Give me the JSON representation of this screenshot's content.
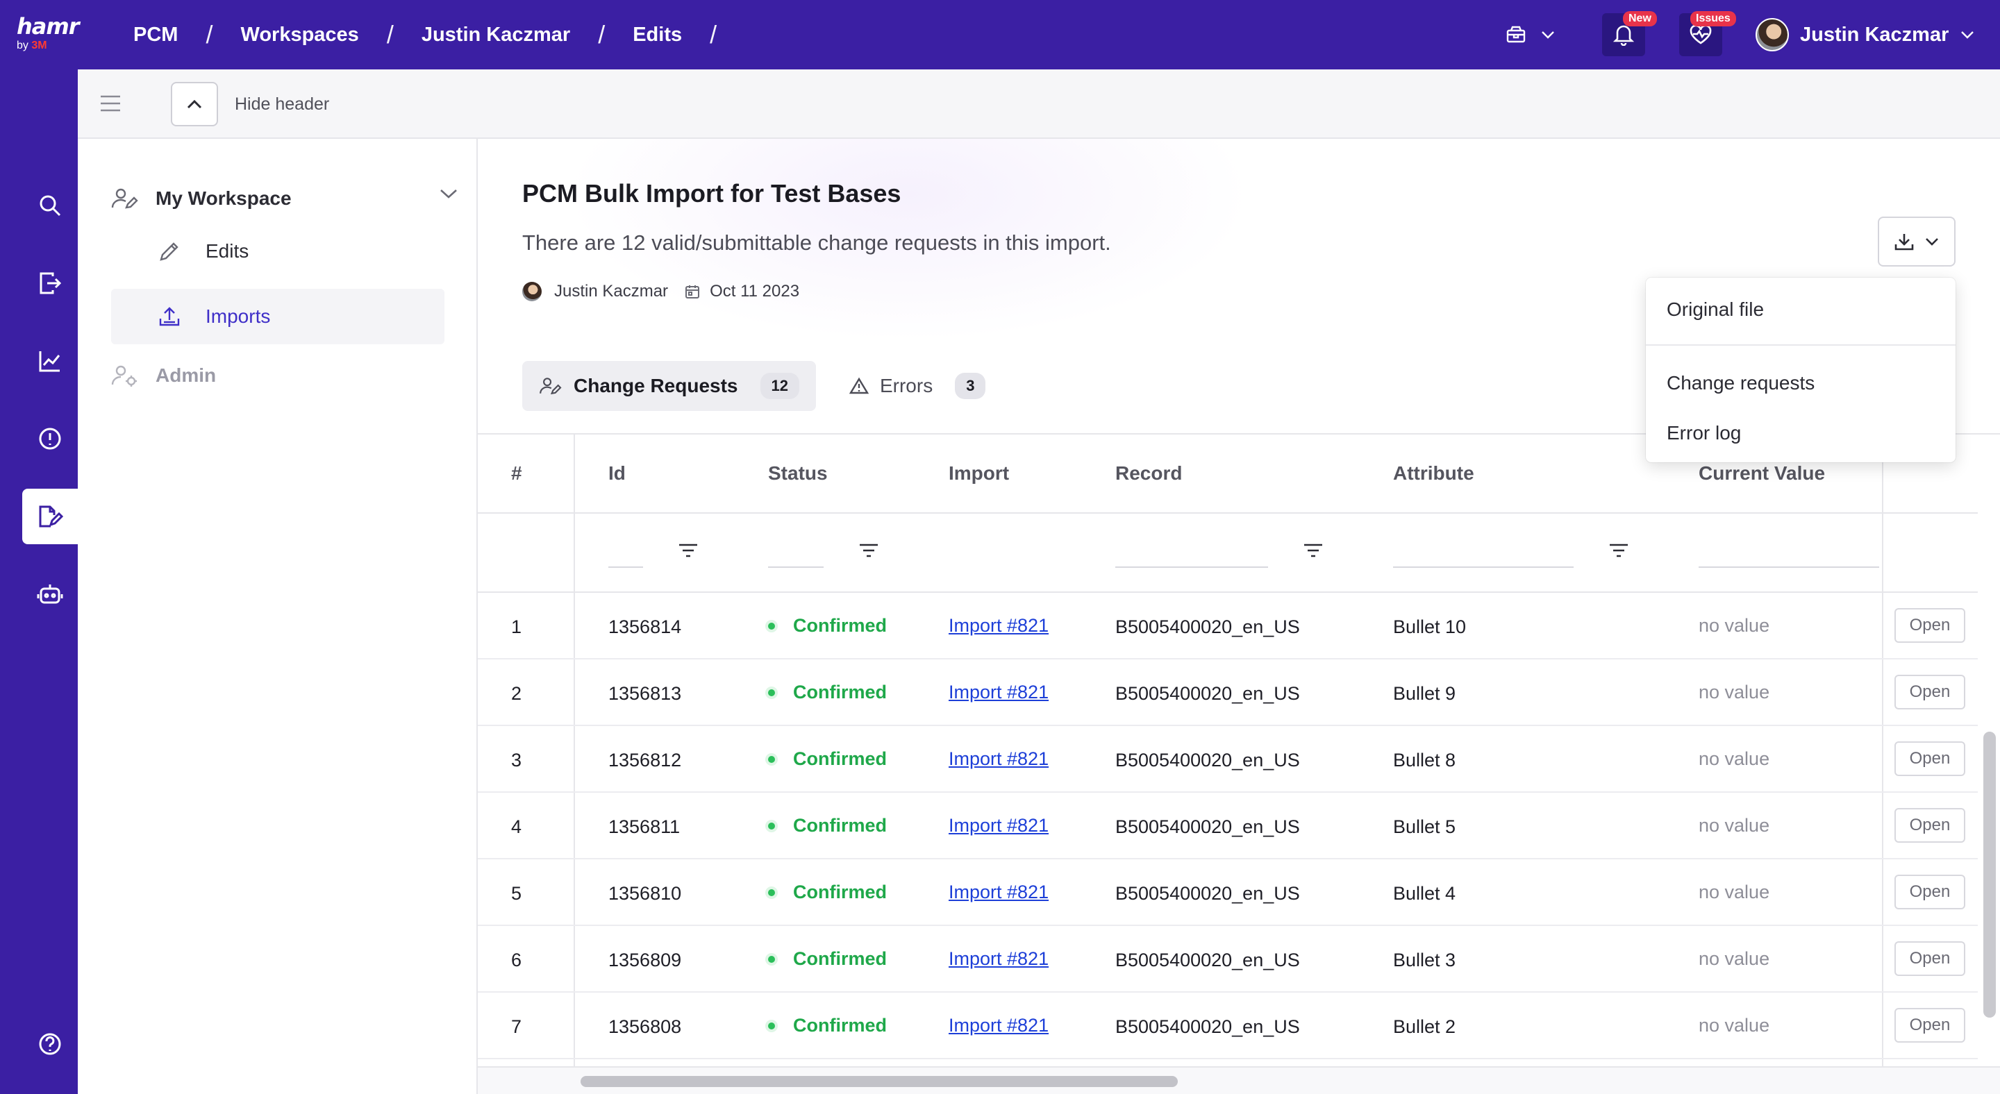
{
  "app": {
    "logo_main": "hamr",
    "logo_by": "by",
    "logo_brand": "3M"
  },
  "breadcrumbs": [
    "PCM",
    "Workspaces",
    "Justin Kaczmar",
    "Edits"
  ],
  "header": {
    "notifications_badge": "New",
    "issues_badge": "Issues",
    "user_name": "Justin Kaczmar"
  },
  "subheader": {
    "hide_label": "Hide header"
  },
  "workspace_nav": {
    "title": "My Workspace",
    "items": [
      {
        "label": "Edits",
        "active": false
      },
      {
        "label": "Imports",
        "active": true
      }
    ],
    "admin_label": "Admin"
  },
  "import": {
    "title": "PCM Bulk Import for Test Bases",
    "subtitle": "There are 12 valid/submittable change requests in this import.",
    "author": "Justin Kaczmar",
    "date": "Oct 11 2023"
  },
  "tabs": [
    {
      "label": "Change Requests",
      "count": "12",
      "active": true
    },
    {
      "label": "Errors",
      "count": "3",
      "active": false
    }
  ],
  "download_menu": {
    "items": [
      "Original file",
      "Change requests",
      "Error log"
    ]
  },
  "table": {
    "columns": [
      "#",
      "Id",
      "Status",
      "Import",
      "Record",
      "Attribute",
      "Current Value"
    ],
    "open_label": "Open",
    "rows": [
      {
        "n": "1",
        "id": "1356814",
        "status": "Confirmed",
        "import": "Import #821",
        "record": "B5005400020_en_US",
        "attribute": "Bullet 10",
        "current": "no value"
      },
      {
        "n": "2",
        "id": "1356813",
        "status": "Confirmed",
        "import": "Import #821",
        "record": "B5005400020_en_US",
        "attribute": "Bullet 9",
        "current": "no value"
      },
      {
        "n": "3",
        "id": "1356812",
        "status": "Confirmed",
        "import": "Import #821",
        "record": "B5005400020_en_US",
        "attribute": "Bullet 8",
        "current": "no value"
      },
      {
        "n": "4",
        "id": "1356811",
        "status": "Confirmed",
        "import": "Import #821",
        "record": "B5005400020_en_US",
        "attribute": "Bullet 5",
        "current": "no value"
      },
      {
        "n": "5",
        "id": "1356810",
        "status": "Confirmed",
        "import": "Import #821",
        "record": "B5005400020_en_US",
        "attribute": "Bullet 4",
        "current": "no value"
      },
      {
        "n": "6",
        "id": "1356809",
        "status": "Confirmed",
        "import": "Import #821",
        "record": "B5005400020_en_US",
        "attribute": "Bullet 3",
        "current": "no value"
      },
      {
        "n": "7",
        "id": "1356808",
        "status": "Confirmed",
        "import": "Import #821",
        "record": "B5005400020_en_US",
        "attribute": "Bullet 2",
        "current": "no value"
      }
    ]
  },
  "colors": {
    "brand": "#3b1fa3",
    "accent": "#3f2fc8",
    "confirmed": "#1fa84a",
    "link": "#1d3fd8"
  }
}
